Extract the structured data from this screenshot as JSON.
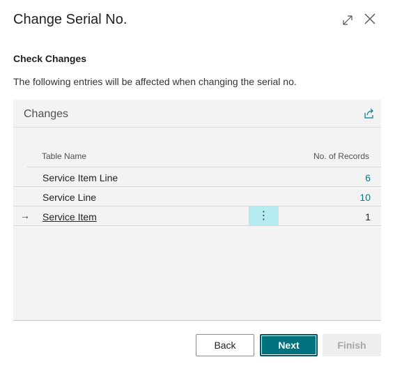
{
  "dialog": {
    "title": "Change Serial No.",
    "expand_icon": "expand-arrows-icon",
    "close_icon": "close-x-icon"
  },
  "section": {
    "heading": "Check Changes",
    "instructions": "The following entries will be affected when changing the serial no."
  },
  "part": {
    "title": "Changes",
    "share_icon": "share-icon",
    "columns": {
      "table_name": "Table Name",
      "no_of_records": "No. of Records"
    },
    "rows": [
      {
        "table_name": "Service Item Line",
        "no_of_records": "6",
        "selected": false
      },
      {
        "table_name": "Service Line",
        "no_of_records": "10",
        "selected": false
      },
      {
        "table_name": "Service Item",
        "no_of_records": "1",
        "selected": true,
        "row_icon": "right-arrow-icon",
        "menu_glyph": "⋮"
      }
    ]
  },
  "buttons": {
    "back": "Back",
    "next": "Next",
    "finish": "Finish"
  },
  "colors": {
    "accent": "#00727e",
    "link": "#00788a",
    "row_menu_highlight": "#b3ebee",
    "part_background": "#f3f3f3"
  }
}
